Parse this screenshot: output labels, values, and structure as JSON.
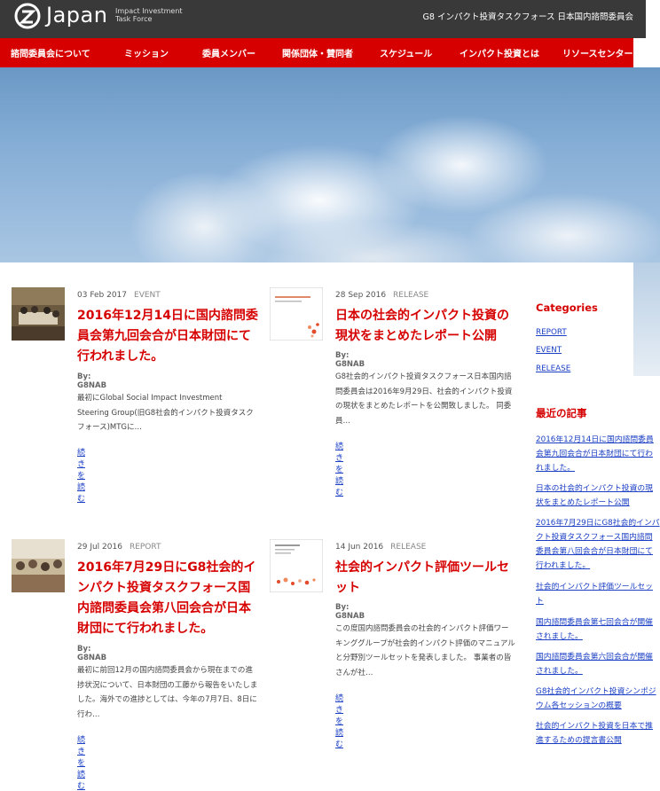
{
  "header": {
    "logo_word": "Japan",
    "logo_sub_1": "Impact Investment",
    "logo_sub_2": "Task Force",
    "org_title": "G8 インパクト投資タスクフォース 日本国内諮問委員会"
  },
  "nav": {
    "items": [
      "諮問委員会について",
      "ミッション",
      "委員メンバー",
      "関係団体・賛同者",
      "スケジュール",
      "インパクト投資とは",
      "リソースセンター"
    ]
  },
  "posts": [
    {
      "date": "03 Feb 2017",
      "category": "EVENT",
      "title": "2016年12月14日に国内諮問委員会第九回会合が日本財団にて行われました。",
      "by": "By: G8NAB",
      "excerpt": "最初にGlobal Social Impact Investment Steering Group(旧G8社会的インパクト投資タスクフォース)MTGに…",
      "more": "続きを読む",
      "thumb": "meeting-photo"
    },
    {
      "date": "28 Sep 2016",
      "category": "RELEASE",
      "title": "日本の社会的インパクト投資の現状をまとめたレポート公開",
      "by": "By: G8NAB",
      "excerpt": "G8社会的インパクト投資タスクフォース日本国内諮問委員会は2016年9月29日、社会的インパクト投資の現状をまとめたレポートを公開致しました。 同委員…",
      "more": "続きを読む",
      "thumb": "report-cover"
    },
    {
      "date": "29 Jul 2016",
      "category": "REPORT",
      "title": "2016年7月29日にG8社会的インパクト投資タスクフォース国内諮問委員会第八回会合が日本財団にて行われました。",
      "by": "By: G8NAB",
      "excerpt": "最初に前回12月の国内諮問委員会から現在までの進捗状況について、日本財団の工藤から報告をいたしました。海外での進捗としては、今年の7月7日、8日に行わ…",
      "more": "続きを読む",
      "thumb": "meeting-photo"
    },
    {
      "date": "14 Jun 2016",
      "category": "RELEASE",
      "title": "社会的インパクト評価ツールセット",
      "by": "By: G8NAB",
      "excerpt": "この度国内諮問委員会の社会的インパクト評価ワーキンググループが社会的インパクト評価のマニュアルと分野別ツールセットを発表しました。 事業者の皆さんが社…",
      "more": "続きを読む",
      "thumb": "toolset-cover"
    }
  ],
  "sidebar": {
    "categories_heading": "Categories",
    "categories": [
      "REPORT",
      "EVENT",
      "RELEASE"
    ],
    "recent_heading": "最近の記事",
    "recent": [
      "2016年12月14日に国内諮問委員会第九回会合が日本財団にて行われました。",
      "日本の社会的インパクト投資の現状をまとめたレポート公開",
      "2016年7月29日にG8社会的インパクト投資タスクフォース国内諮問委員会第八回会合が日本財団にて行われました。",
      "社会的インパクト評価ツールセット",
      "国内諮問委員会第七回会合が開催されました。",
      "国内諮問委員会第六回会合が開催されました。",
      "G8社会的インパクト投資シンポジウム各セッションの概要",
      "社会的インパクト投資を日本で推進するための提言書公開"
    ]
  },
  "colors": {
    "accent": "#d60000",
    "header_bg": "#393939",
    "link": "#1a3fc4"
  }
}
